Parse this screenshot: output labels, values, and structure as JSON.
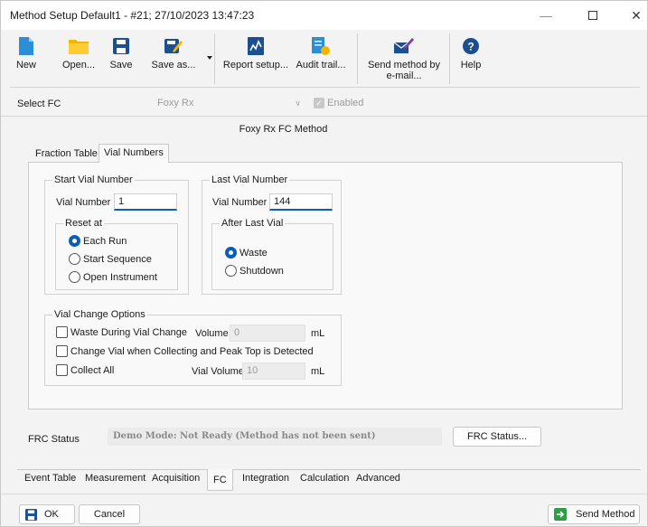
{
  "window": {
    "title": "Method Setup Default1 - #21;  27/10/2023  13:47:23",
    "minimize_glyph": "—",
    "close_glyph": "✕"
  },
  "toolbar": {
    "new_label": "New",
    "open_label": "Open...",
    "save_label": "Save",
    "save_as_label": "Save as...",
    "report_setup_label": "Report setup...",
    "audit_trail_label": "Audit trail...",
    "send_method_email_line1": "Send method by",
    "send_method_email_line2": "e-mail...",
    "help_label": "Help"
  },
  "select_fc": {
    "label": "Select FC",
    "value": "Foxy Rx",
    "arrow_glyph": "∨",
    "enabled_label": "Enabled",
    "check_glyph": "✓"
  },
  "method_title": "Foxy Rx FC Method",
  "inner_tabs": {
    "fraction_table": "Fraction Table",
    "vial_numbers": "Vial Numbers"
  },
  "start_vial": {
    "group_title": "Start Vial Number",
    "vial_number_label": "Vial Number",
    "vial_number_value": "1",
    "reset_group_title": "Reset at",
    "options": [
      "Each Run",
      "Start Sequence",
      "Open Instrument"
    ],
    "selected": "Each Run"
  },
  "last_vial": {
    "group_title": "Last Vial Number",
    "vial_number_label": "Vial Number",
    "vial_number_value": "144",
    "after_group_title": "After Last Vial",
    "options": [
      "Waste",
      "Shutdown"
    ],
    "selected": "Waste"
  },
  "vial_change": {
    "group_title": "Vial Change Options",
    "waste_during_label": "Waste During Vial Change",
    "volume_label": "Volume",
    "volume_value": "0",
    "volume_unit": "mL",
    "change_vial_label": "Change Vial when Collecting and Peak Top is Detected",
    "collect_all_label": "Collect All",
    "vial_volume_label": "Vial Volume",
    "vial_volume_value": "10",
    "vial_volume_unit": "mL"
  },
  "frc_status": {
    "label": "FRC Status",
    "text": "Demo Mode: Not Ready (Method has not been sent)",
    "button_label": "FRC Status..."
  },
  "bottom_tabs": [
    "Event Table",
    "Measurement",
    "Acquisition",
    "FC",
    "Integration",
    "Calculation",
    "Advanced"
  ],
  "footer": {
    "ok_label": "OK",
    "cancel_label": "Cancel",
    "send_method_label": "Send Method"
  },
  "colors": {
    "accent": "#0a5fb4",
    "file_icon": "#2b8fd6",
    "folder_icon": "#f2b600",
    "save_icon": "#1b4f8f",
    "green_icon": "#2f9e44"
  }
}
